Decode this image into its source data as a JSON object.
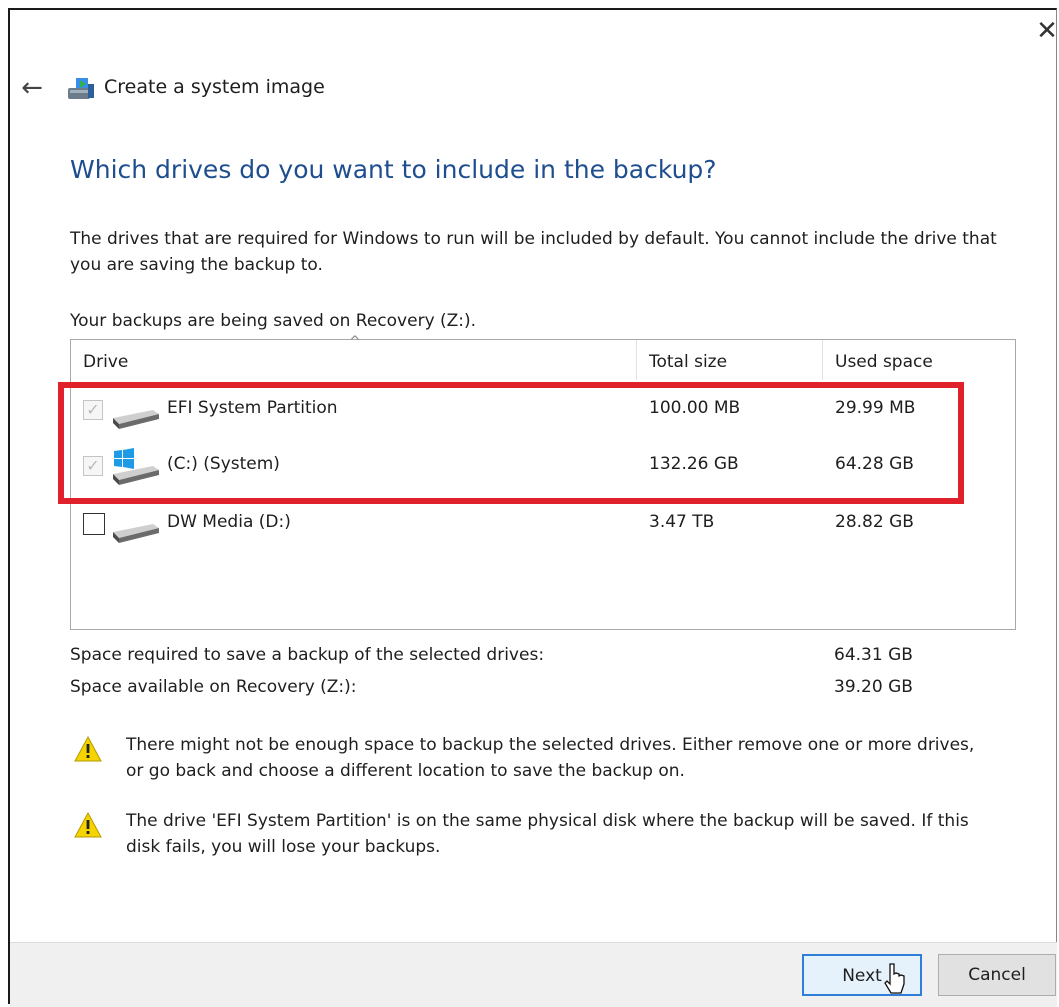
{
  "window": {
    "title": "Create a system image",
    "close_glyph": "✕",
    "back_glyph": "←"
  },
  "heading": "Which drives do you want to include in the backup?",
  "description": "The drives that are required for Windows to run will be included by default. You cannot include the drive that you are saving the backup to.",
  "saved_on": "Your backups are being saved on Recovery (Z:).",
  "table": {
    "columns": [
      "Drive",
      "Total size",
      "Used space"
    ],
    "rows": [
      {
        "name": "EFI System Partition",
        "total": "100.00 MB",
        "used": "29.99 MB",
        "checked": true,
        "enabled": false,
        "icon": "drive-icon"
      },
      {
        "name": "(C:) (System)",
        "total": "132.26 GB",
        "used": "64.28 GB",
        "checked": true,
        "enabled": false,
        "icon": "windows-drive-icon"
      },
      {
        "name": "DW Media (D:)",
        "total": "3.47 TB",
        "used": "28.82 GB",
        "checked": false,
        "enabled": true,
        "icon": "drive-icon"
      }
    ]
  },
  "summary": {
    "required_label": "Space required to save a backup of the selected drives:",
    "required_value": "64.31 GB",
    "available_label": "Space available on Recovery (Z:):",
    "available_value": "39.20 GB"
  },
  "warnings": [
    "There might not be enough space to backup the selected drives. Either remove one or more drives, or go back and choose a different location to save the backup on.",
    "The drive 'EFI System Partition' is on the same physical disk where the backup will be saved. If this disk fails, you will lose your backups."
  ],
  "buttons": {
    "next": "Next",
    "cancel": "Cancel"
  },
  "colors": {
    "heading": "#1f4e8f",
    "highlight": "#e0202a",
    "warning": "#f5d400"
  }
}
